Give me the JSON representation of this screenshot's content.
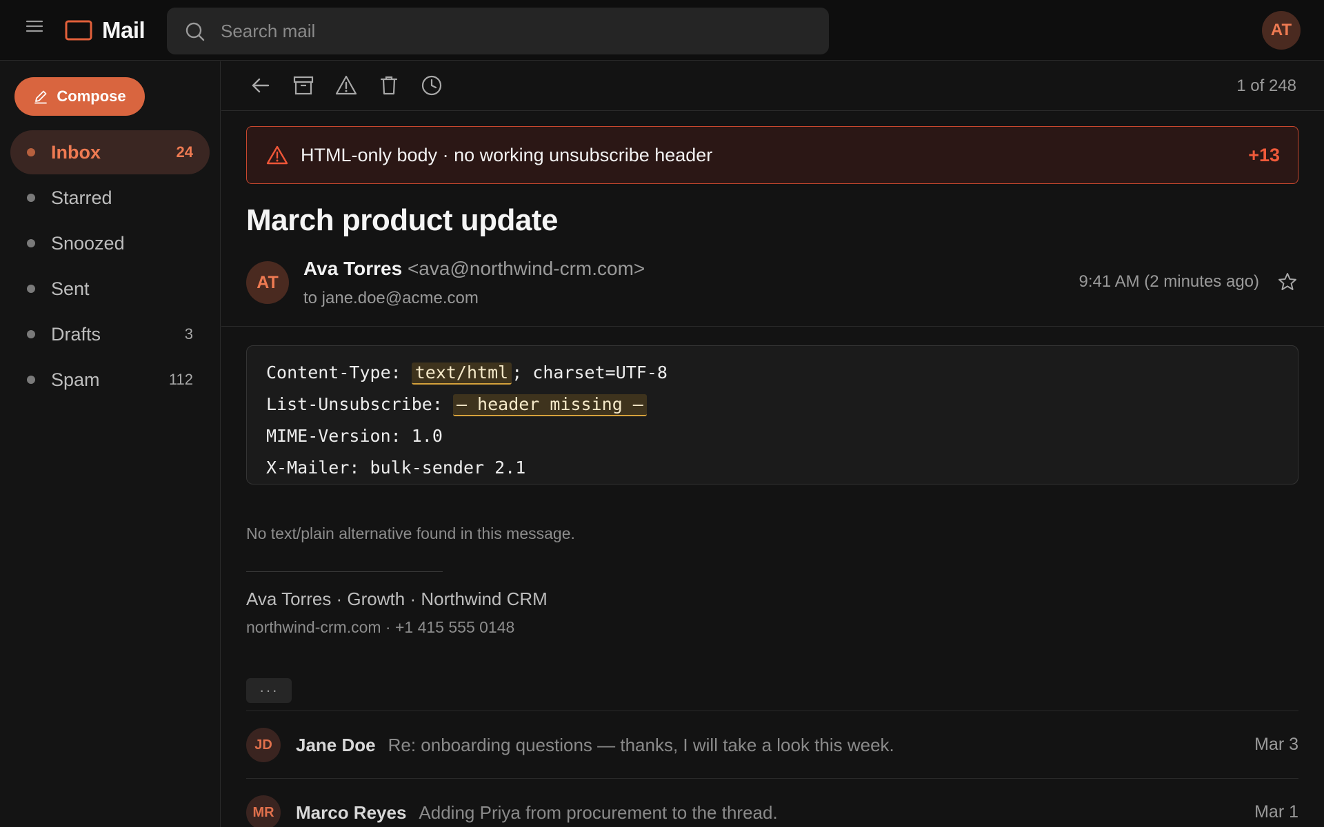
{
  "app": {
    "title": "Mail",
    "search_placeholder": "Search mail",
    "user_initials": "AT"
  },
  "sidebar": {
    "compose_label": "Compose",
    "items": [
      {
        "label": "Inbox",
        "count": "24",
        "active": true
      },
      {
        "label": "Starred",
        "count": ""
      },
      {
        "label": "Snoozed",
        "count": ""
      },
      {
        "label": "Sent",
        "count": ""
      },
      {
        "label": "Drafts",
        "count": "3"
      },
      {
        "label": "Spam",
        "count": "112"
      }
    ]
  },
  "toolbar": {
    "icons": [
      "back-arrow-icon",
      "archive-icon",
      "report-spam-icon",
      "delete-icon",
      "snooze-clock-icon"
    ],
    "pager": "1 of 248"
  },
  "alert": {
    "icon": "warning-triangle-icon",
    "text": "HTML-only body · no working unsubscribe header",
    "score": "+13"
  },
  "message": {
    "subject": "March product update",
    "sender_initials": "AT",
    "sender_name": "Ava Torres",
    "sender_email": "<ava@northwind-crm.com>",
    "recipient": "to jane.doe@acme.com",
    "timestamp": "9:41 AM (2 minutes ago)",
    "headers": {
      "content_type_key": "Content-Type: ",
      "content_type_value": "text/html",
      "content_type_rest": "; charset=UTF-8",
      "unsubscribe_key": "List-Unsubscribe: ",
      "unsubscribe_value": "— header missing —",
      "mime_line": "MIME-Version: 1.0",
      "mailer_line": "X-Mailer: bulk-sender 2.1"
    },
    "note": "No text/plain alternative found in this message.",
    "signature_line1": "Ava Torres · Growth · Northwind CRM",
    "signature_line2": "northwind-crm.com · +1 415 555 0148",
    "more_label": "···"
  },
  "thread": [
    {
      "initials": "JD",
      "name": "Jane Doe",
      "snippet": "Re: onboarding questions — thanks, I will take a look this week.",
      "date": "Mar 3"
    },
    {
      "initials": "MR",
      "name": "Marco Reyes",
      "snippet": "Adding Priya from procurement to the thread.",
      "date": "Mar 1"
    }
  ],
  "colors": {
    "accent": "#d9653f",
    "accent_text": "#ee7a52",
    "alert_border": "#c8472e",
    "highlight": "#d6a23c",
    "background": "#131313"
  }
}
